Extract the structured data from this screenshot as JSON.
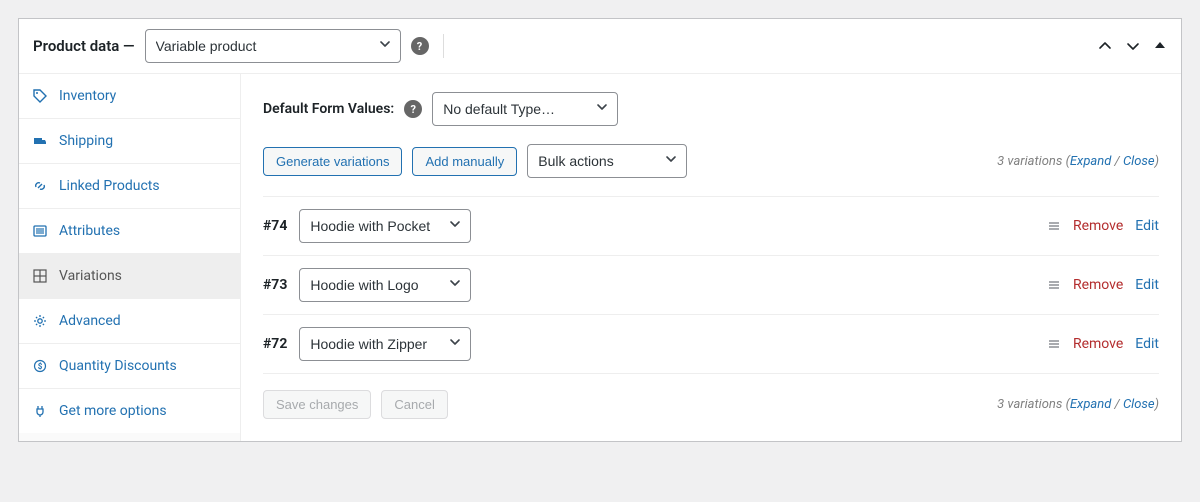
{
  "header": {
    "title_prefix": "Product data —",
    "product_type": "Variable product"
  },
  "sidebar": {
    "items": [
      {
        "label": "Inventory"
      },
      {
        "label": "Shipping"
      },
      {
        "label": "Linked Products"
      },
      {
        "label": "Attributes"
      },
      {
        "label": "Variations"
      },
      {
        "label": "Advanced"
      },
      {
        "label": "Quantity Discounts"
      },
      {
        "label": "Get more options"
      }
    ]
  },
  "main": {
    "default_label": "Default Form Values:",
    "default_value": "No default Type…",
    "generate_btn": "Generate variations",
    "add_btn": "Add manually",
    "bulk_label": "Bulk actions",
    "count_text": "3 variations",
    "expand_label": "Expand",
    "close_label": "Close",
    "variations": [
      {
        "id": "#74",
        "value": "Hoodie with Pocket"
      },
      {
        "id": "#73",
        "value": "Hoodie with Logo"
      },
      {
        "id": "#72",
        "value": "Hoodie with Zipper"
      }
    ],
    "remove_label": "Remove",
    "edit_label": "Edit",
    "save_label": "Save changes",
    "cancel_label": "Cancel"
  }
}
